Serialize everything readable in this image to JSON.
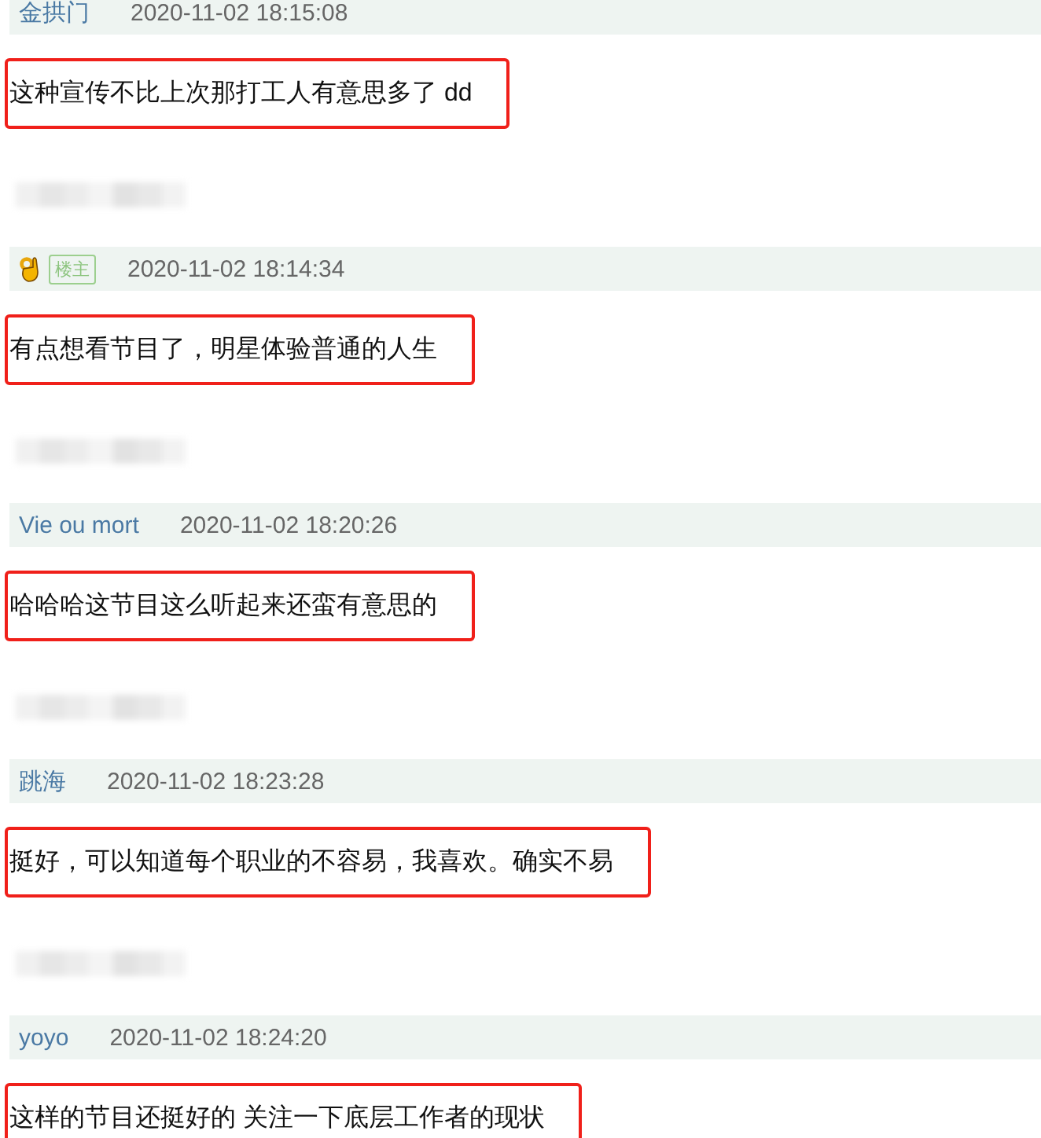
{
  "comments": [
    {
      "kind": "user",
      "user": "金拱门",
      "time": "2020-11-02 18:15:08",
      "text": "这种宣传不比上次那打工人有意思多了 dd",
      "blurred_reply": true
    },
    {
      "kind": "op",
      "badge": "楼主",
      "time": "2020-11-02 18:14:34",
      "text": "有点想看节目了，明星体验普通的人生",
      "blurred_reply": true
    },
    {
      "kind": "user",
      "user": "Vie ou mort",
      "time": "2020-11-02 18:20:26",
      "text": "哈哈哈这节目这么听起来还蛮有意思的",
      "blurred_reply": true
    },
    {
      "kind": "user",
      "user": "跳海",
      "time": "2020-11-02 18:23:28",
      "text": "挺好，可以知道每个职业的不容易，我喜欢。确实不易",
      "blurred_reply": true
    },
    {
      "kind": "user",
      "user": "yoyo",
      "time": "2020-11-02 18:24:20",
      "text": "这样的节目还挺好的 关注一下底层工作者的现状",
      "blurred_reply": false
    }
  ]
}
